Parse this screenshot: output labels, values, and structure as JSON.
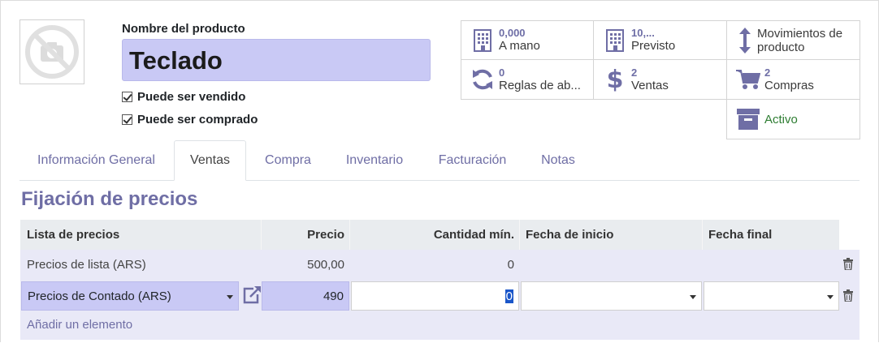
{
  "product": {
    "name_label": "Nombre del producto",
    "name_value": "Teclado",
    "can_be_sold": "Puede ser vendido",
    "can_be_purchased": "Puede ser comprado"
  },
  "smart_buttons": {
    "on_hand": {
      "value": "0,000",
      "label": "A mano"
    },
    "forecast": {
      "value": "10,...",
      "label": "Previsto"
    },
    "moves": {
      "label": "Movimientos de producto"
    },
    "rules": {
      "value": "0",
      "label": "Reglas de ab..."
    },
    "sales": {
      "value": "2",
      "label": "Ventas"
    },
    "purchases": {
      "value": "2",
      "label": "Compras"
    },
    "active": {
      "label": "Activo"
    }
  },
  "tabs": [
    {
      "label": "Información General"
    },
    {
      "label": "Ventas"
    },
    {
      "label": "Compra"
    },
    {
      "label": "Inventario"
    },
    {
      "label": "Facturación"
    },
    {
      "label": "Notas"
    }
  ],
  "pricing": {
    "title": "Fijación de precios",
    "columns": [
      "Lista de precios",
      "Precio",
      "Cantidad mín.",
      "Fecha de inicio",
      "Fecha final"
    ],
    "rows": [
      {
        "pricelist": "Precios de lista (ARS)",
        "price": "500,00",
        "min_qty": "0"
      }
    ],
    "edit_row": {
      "pricelist": "Precios de Contado (ARS)",
      "price": "490",
      "min_qty": "0"
    },
    "add_line": "Añadir un elemento"
  },
  "colors": {
    "accent": "#6f6ea5",
    "field_highlight": "#c9c9f5"
  }
}
